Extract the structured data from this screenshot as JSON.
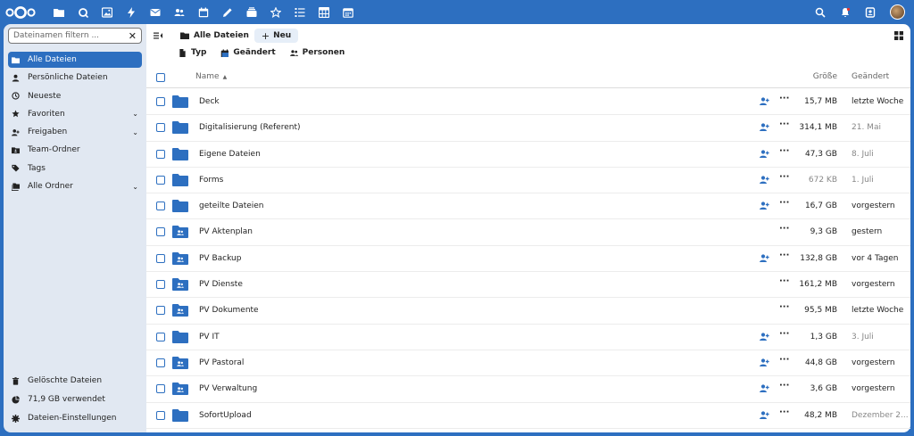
{
  "colors": {
    "primary": "#2d6fc0",
    "sidebar_bg": "#e1e8f2",
    "main_bg": "#ffffff"
  },
  "topbar": {
    "apps": [
      "files-icon",
      "search-talk-icon",
      "photos-icon",
      "activity-icon",
      "mail-icon",
      "contacts-icon",
      "calendar-icon",
      "notes-icon",
      "deck-icon",
      "starred-icon",
      "tasks-icon",
      "tables-icon",
      "calendar2-icon"
    ],
    "right_icons": [
      "search-icon",
      "notifications-icon",
      "contacts-menu-icon"
    ]
  },
  "sidebar": {
    "search_placeholder": "Dateinamen filtern ...",
    "items": [
      {
        "label": "Alle Dateien",
        "icon": "folder-icon",
        "active": true
      },
      {
        "label": "Persönliche Dateien",
        "icon": "user-icon"
      },
      {
        "label": "Neueste",
        "icon": "history-icon"
      },
      {
        "label": "Favoriten",
        "icon": "star-icon",
        "expand": true
      },
      {
        "label": "Freigaben",
        "icon": "share-icon",
        "expand": true
      },
      {
        "label": "Team-Ordner",
        "icon": "team-folder-icon"
      },
      {
        "label": "Tags",
        "icon": "tag-icon"
      },
      {
        "label": "Alle Ordner",
        "icon": "folders-icon",
        "expand": true
      }
    ],
    "bottom": [
      {
        "label": "Gelöschte Dateien",
        "icon": "trash-icon"
      },
      {
        "label": "71,9 GB verwendet",
        "icon": "quota-icon"
      },
      {
        "label": "Dateien-Einstellungen",
        "icon": "settings-icon"
      }
    ]
  },
  "toolbar": {
    "breadcrumb": "Alle Dateien",
    "new_label": "Neu"
  },
  "filters": [
    {
      "label": "Typ",
      "icon": "file-icon"
    },
    {
      "label": "Geändert",
      "icon": "calendar-icon"
    },
    {
      "label": "Personen",
      "icon": "people-icon"
    }
  ],
  "table": {
    "col_name": "Name",
    "col_size": "Größe",
    "col_modified": "Geändert",
    "rows": [
      {
        "name": "Deck",
        "type": "folder",
        "shared": true,
        "size": "15,7 MB",
        "modified": "letzte Woche",
        "light": false
      },
      {
        "name": "Digitalisierung (Referent)",
        "type": "folder",
        "shared": true,
        "size": "314,1 MB",
        "modified": "21. Mai",
        "light": true
      },
      {
        "name": "Eigene Dateien",
        "type": "folder",
        "shared": true,
        "size": "47,3 GB",
        "modified": "8. Juli",
        "light": true
      },
      {
        "name": "Forms",
        "type": "folder",
        "shared": true,
        "size": "672 KB",
        "modified": "1. Juli",
        "light": true,
        "size_light": true
      },
      {
        "name": "geteilte Dateien",
        "type": "folder",
        "shared": true,
        "size": "16,7 GB",
        "modified": "vorgestern",
        "light": false
      },
      {
        "name": "PV Aktenplan",
        "type": "group",
        "shared": false,
        "size": "9,3 GB",
        "modified": "gestern",
        "light": false
      },
      {
        "name": "PV Backup",
        "type": "group",
        "shared": true,
        "size": "132,8 GB",
        "modified": "vor 4 Tagen",
        "light": false
      },
      {
        "name": "PV Dienste",
        "type": "group",
        "shared": false,
        "size": "161,2 MB",
        "modified": "vorgestern",
        "light": false
      },
      {
        "name": "PV Dokumente",
        "type": "group",
        "shared": false,
        "size": "95,5 MB",
        "modified": "letzte Woche",
        "light": false
      },
      {
        "name": "PV IT",
        "type": "folder",
        "shared": true,
        "size": "1,3 GB",
        "modified": "3. Juli",
        "light": true
      },
      {
        "name": "PV Pastoral",
        "type": "group",
        "shared": true,
        "size": "44,8 GB",
        "modified": "vorgestern",
        "light": false
      },
      {
        "name": "PV Verwaltung",
        "type": "group",
        "shared": true,
        "size": "3,6 GB",
        "modified": "vorgestern",
        "light": false
      },
      {
        "name": "SofortUpload",
        "type": "folder",
        "shared": true,
        "size": "48,2 MB",
        "modified": "Dezember 2...",
        "light": true
      }
    ]
  }
}
